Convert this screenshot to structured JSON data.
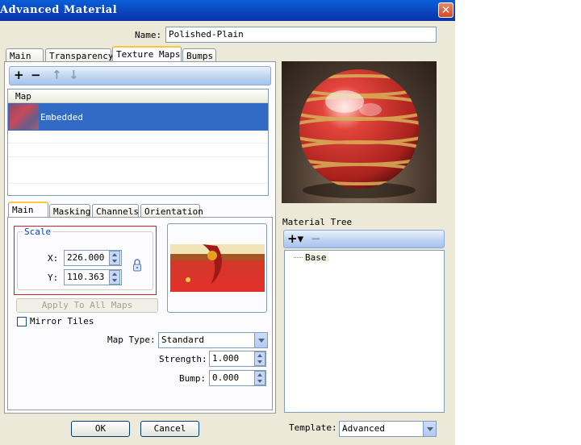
{
  "window": {
    "title": "Advanced Material",
    "close_icon": "close-icon"
  },
  "name_field": {
    "label": "Name:",
    "value": "Polished-Plain"
  },
  "top_tabs": [
    {
      "label": "Main"
    },
    {
      "label": "Transparency"
    },
    {
      "label": "Texture Maps",
      "active": true
    },
    {
      "label": "Bumps"
    }
  ],
  "map_toolbar": {
    "add_icon": "+",
    "remove_icon": "−",
    "up_icon": "↑",
    "down_icon": "↓"
  },
  "map_list": {
    "header": "Map",
    "rows": [
      {
        "label": "Embedded",
        "selected": true
      }
    ]
  },
  "sub_tabs": [
    {
      "label": "Main",
      "active": true
    },
    {
      "label": "Masking"
    },
    {
      "label": "Channels"
    },
    {
      "label": "Orientation"
    }
  ],
  "scale": {
    "legend": "Scale",
    "x_label": "X:",
    "x_value": "226.000",
    "y_label": "Y:",
    "y_value": "110.363",
    "lock_icon": "lock-icon"
  },
  "apply_all_label": "Apply To All Maps",
  "mirror_tiles_label": "Mirror Tiles",
  "map_type": {
    "label": "Map Type:",
    "value": "Standard"
  },
  "strength": {
    "label": "Strength:",
    "value": "1.000"
  },
  "bump": {
    "label": "Bump:",
    "value": "0.000"
  },
  "buttons": {
    "ok": "OK",
    "cancel": "Cancel"
  },
  "material_tree": {
    "label": "Material Tree",
    "add_icon": "+▾",
    "remove_icon": "−",
    "items": [
      "Base"
    ]
  },
  "template": {
    "label": "Template:",
    "value": "Advanced"
  },
  "colors": {
    "title_bar": "#0a4fc8",
    "selection": "#316ac5",
    "scale_border": "#cc2222",
    "accent_tab": "#ffc83c"
  }
}
